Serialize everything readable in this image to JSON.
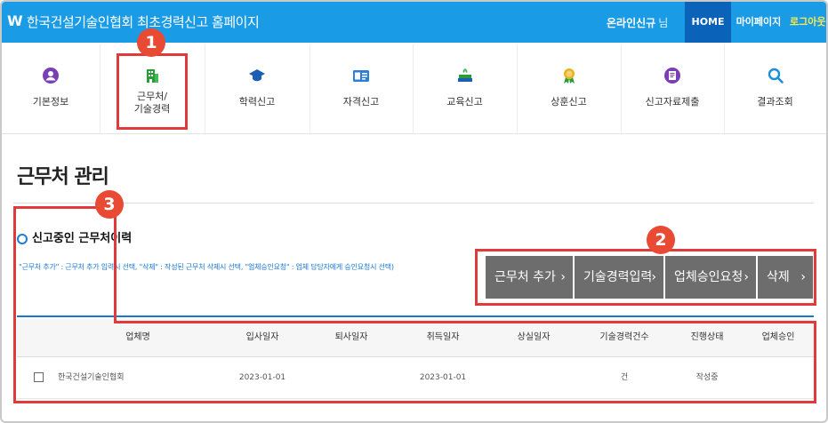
{
  "header": {
    "logo_glyph": "W",
    "title": "한국건설기술인협회 최초경력신고 홈페이지",
    "user_name": "온라인신규",
    "user_suffix": "님",
    "nav": {
      "home": "HOME",
      "mypage": "마이페이지",
      "logout": "로그아웃"
    },
    "bg_color": "#1a9be6"
  },
  "menu": {
    "items": [
      {
        "label": "기본정보",
        "icon": "person-icon"
      },
      {
        "label": "근무처/\n기술경력",
        "icon": "building-icon"
      },
      {
        "label": "학력신고",
        "icon": "graduation-cap-icon"
      },
      {
        "label": "자격신고",
        "icon": "id-card-icon"
      },
      {
        "label": "교육신고",
        "icon": "books-icon"
      },
      {
        "label": "상훈신고",
        "icon": "medal-icon"
      },
      {
        "label": "신고자료제출",
        "icon": "document-icon"
      },
      {
        "label": "결과조회",
        "icon": "magnifier-icon"
      }
    ]
  },
  "main": {
    "page_title": "근무처 관리",
    "section_title": "신고중인 근무처이력",
    "hint": "\"근무처 추가\" : 근무처 추가 입력시 선택, \"삭제\" : 작성된 근무처 삭제시 선택, \"업체승인요청\" : 업체 담당자에게 승인요청시 선택)",
    "buttons": [
      {
        "label": "근무처 추가",
        "chevron": "›"
      },
      {
        "label": "기술경력입력",
        "chevron": "›"
      },
      {
        "label": "업체승인요청",
        "chevron": "›"
      },
      {
        "label": "삭제",
        "chevron": "›"
      }
    ],
    "table": {
      "headers": [
        "업체명",
        "입사일자",
        "퇴사일자",
        "취득일자",
        "상실일자",
        "기술경력건수",
        "진행상태",
        "업체승인"
      ],
      "rows": [
        {
          "company": "한국건설기술인협회",
          "join_date": "2023-01-01",
          "leave_date": "",
          "acquire_date": "2023-01-01",
          "loss_date": "",
          "career_count": "건",
          "status": "작성중",
          "approval": ""
        }
      ]
    }
  },
  "annotations": [
    {
      "number": "1"
    },
    {
      "number": "2"
    },
    {
      "number": "3"
    }
  ],
  "colors": {
    "accent": "#1a9be6",
    "annotation": "#e03a3a",
    "button": "#6d6d6d",
    "table_rule": "#1a78d4"
  }
}
